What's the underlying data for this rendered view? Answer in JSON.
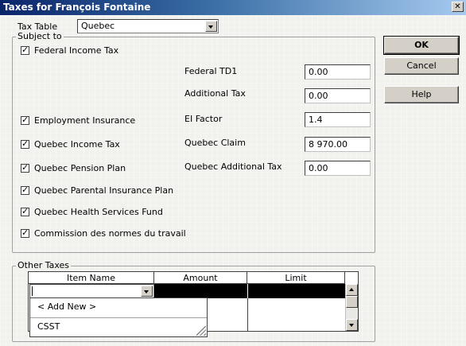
{
  "window": {
    "title": "Taxes for François Fontaine",
    "close_glyph": "✕"
  },
  "tax_table": {
    "label": "Tax Table",
    "value": "Quebec"
  },
  "subject_to": {
    "legend": "Subject to",
    "checkboxes": [
      {
        "label": "Federal Income Tax",
        "checked": true
      },
      {
        "label": "Employment Insurance",
        "checked": true
      },
      {
        "label": "Quebec Income Tax",
        "checked": true
      },
      {
        "label": "Quebec Pension Plan",
        "checked": true
      },
      {
        "label": "Quebec Parental Insurance Plan",
        "checked": true
      },
      {
        "label": "Quebec Health Services Fund",
        "checked": true
      },
      {
        "label": "Commission des normes du travail",
        "checked": true
      }
    ],
    "fields": [
      {
        "label": "Federal TD1",
        "value": "0.00"
      },
      {
        "label": "Additional Tax",
        "value": "0.00"
      },
      {
        "label": "EI Factor",
        "value": "1.4"
      },
      {
        "label": "Quebec Claim",
        "value": "8 970.00"
      },
      {
        "label": "Quebec Additional Tax",
        "value": "0.00"
      }
    ]
  },
  "buttons": {
    "ok": "OK",
    "cancel": "Cancel",
    "help": "Help"
  },
  "other_taxes": {
    "legend": "Other Taxes",
    "columns": [
      "Item Name",
      "Amount",
      "Limit"
    ],
    "editing_value": "",
    "dropdown_options": [
      "< Add New >",
      "CSST"
    ]
  },
  "check_glyph": "✓"
}
